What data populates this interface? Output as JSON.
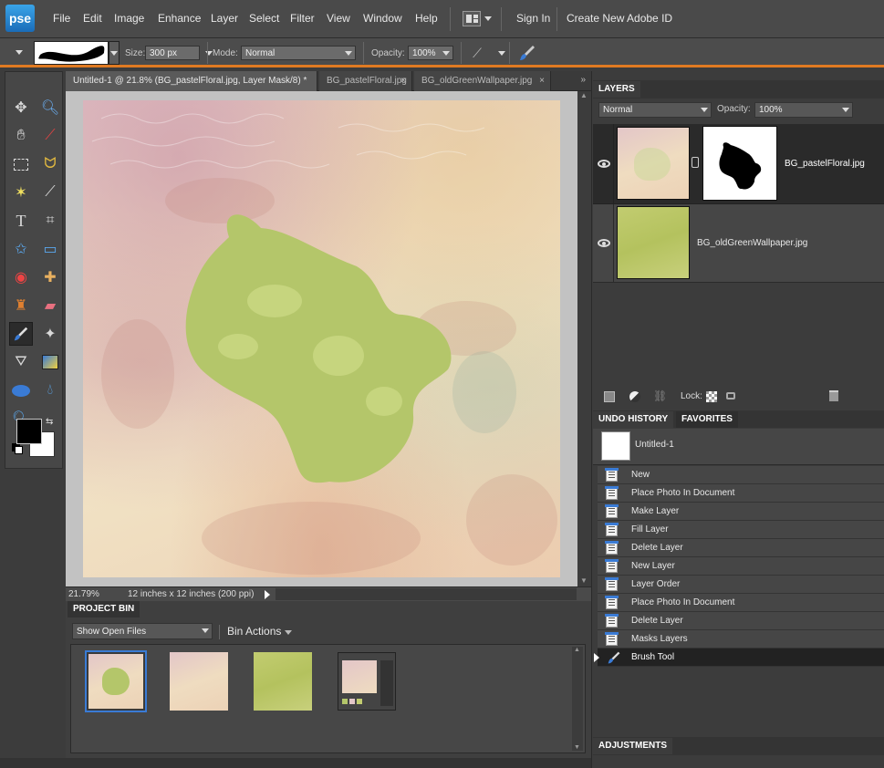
{
  "app": {
    "logo": "pse"
  },
  "menu": {
    "items": [
      "File",
      "Edit",
      "Image",
      "Enhance",
      "Layer",
      "Select",
      "Filter",
      "View",
      "Window",
      "Help"
    ],
    "sign_in": "Sign In",
    "create_id": "Create New Adobe ID"
  },
  "options": {
    "size_label": "Size:",
    "size_value": "300 px",
    "mode_label": "Mode:",
    "mode_value": "Normal",
    "opacity_label": "Opacity:",
    "opacity_value": "100%"
  },
  "tabs": [
    {
      "label": "Untitled-1 @ 21.8% (BG_pastelFloral.jpg, Layer Mask/8) *",
      "active": true
    },
    {
      "label": "BG_pastelFloral.jpg",
      "active": false
    },
    {
      "label": "BG_oldGreenWallpaper.jpg",
      "active": false
    }
  ],
  "status": {
    "zoom": "21.79%",
    "doc_size": "12 inches x 12 inches (200 ppi)"
  },
  "project_bin": {
    "title": "PROJECT BIN",
    "filter": "Show Open Files",
    "actions": "Bin Actions"
  },
  "layers_panel": {
    "title": "LAYERS",
    "blend_mode": "Normal",
    "opacity_label": "Opacity:",
    "opacity_value": "100%",
    "layers": [
      {
        "name": "BG_pastelFloral.jpg",
        "visible": true,
        "has_mask": true
      },
      {
        "name": "BG_oldGreenWallpaper.jpg",
        "visible": true,
        "has_mask": false
      }
    ],
    "lock_label": "Lock:"
  },
  "undo_history": {
    "title": "UNDO HISTORY",
    "favorites_tab": "FAVORITES",
    "snapshot": "Untitled-1",
    "steps": [
      "New",
      "Place Photo In Document",
      "Make Layer",
      "Fill Layer",
      "Delete Layer",
      "New Layer",
      "Layer Order",
      "Place Photo In Document",
      "Delete Layer",
      "Masks Layers",
      "Brush Tool"
    ],
    "current_step": "Brush Tool"
  },
  "adjustments": {
    "title": "ADJUSTMENTS"
  },
  "colors": {
    "accent_orange": "#e07a22",
    "selection_blue": "#3a7bd5",
    "foreground": "#000000",
    "background": "#ffffff",
    "blob_green": "#b4c66a"
  }
}
